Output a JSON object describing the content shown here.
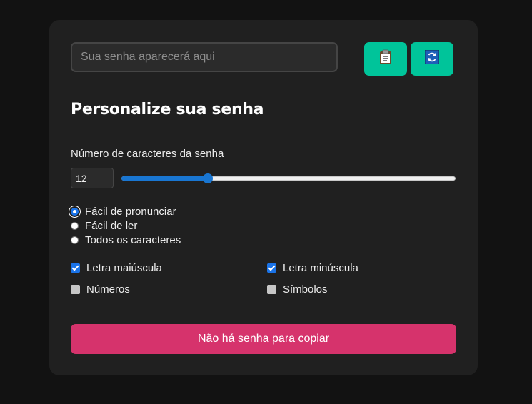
{
  "password": {
    "value": "",
    "placeholder": "Sua senha aparecerá aqui",
    "copy_icon": "clipboard-icon",
    "refresh_icon": "refresh-icon",
    "accent_color": "#00c49a"
  },
  "settings": {
    "heading": "Personalize sua senha",
    "length_label": "Número de caracteres da senha",
    "length_value": "12",
    "length_min": 4,
    "length_max": 32,
    "slider_fraction": 0.25
  },
  "modes": [
    {
      "label": "Fácil de pronunciar",
      "checked": true
    },
    {
      "label": "Fácil de ler",
      "checked": false
    },
    {
      "label": "Todos os caracteres",
      "checked": false
    }
  ],
  "options": [
    {
      "label": "Letra maiúscula",
      "checked": true
    },
    {
      "label": "Letra minúscula",
      "checked": true
    },
    {
      "label": "Números",
      "checked": false
    },
    {
      "label": "Símbolos",
      "checked": false
    }
  ],
  "copy_button": {
    "label": "Não há senha para copiar",
    "color": "#d6336c"
  }
}
